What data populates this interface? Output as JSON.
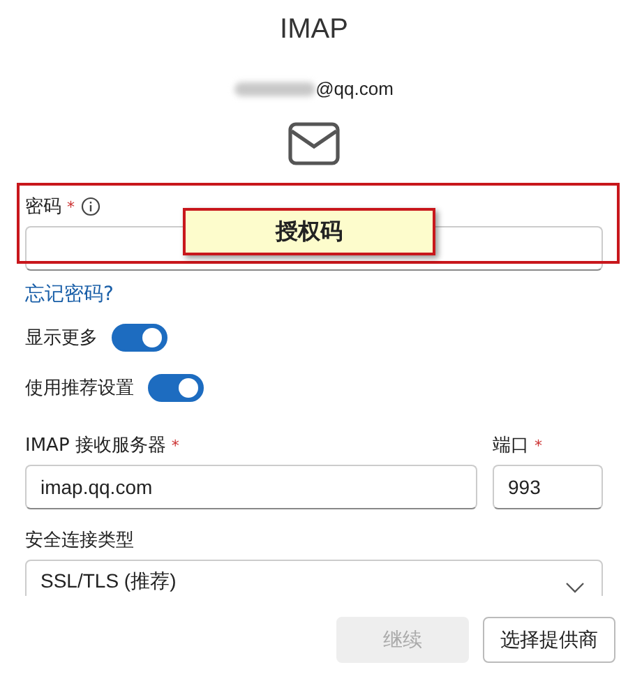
{
  "title": "IMAP",
  "email": {
    "redacted": true,
    "visible": "@qq.com"
  },
  "password": {
    "label": "密码",
    "required_mark": "*",
    "info_icon": true
  },
  "forgot_link": "忘记密码?",
  "toggles": [
    {
      "label": "显示更多",
      "on": true
    },
    {
      "label": "使用推荐设置",
      "on": true
    }
  ],
  "server": {
    "label": "IMAP 接收服务器",
    "required_mark": "*",
    "value": "imap.qq.com"
  },
  "port": {
    "label": "端口",
    "required_mark": "*",
    "value": "993"
  },
  "security": {
    "label": "安全连接类型",
    "value": "SSL/TLS (推荐)"
  },
  "buttons": [
    {
      "label": "继续",
      "disabled": true
    },
    {
      "label": "选择提供商",
      "disabled": false
    }
  ],
  "annotation": {
    "text": "授权码"
  }
}
